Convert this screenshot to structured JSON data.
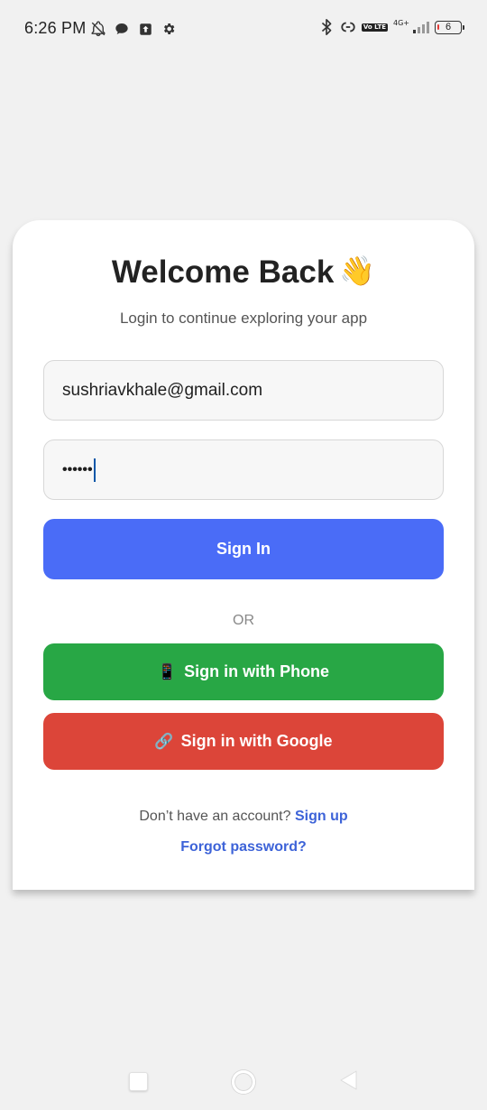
{
  "status_bar": {
    "time": "6:26 PM",
    "network_type": "4G+",
    "volte_label": "Vo LTE",
    "battery_level": "6",
    "icons_left": [
      "bell-off-icon",
      "chat-bubble-icon",
      "upload-icon",
      "gear-icon"
    ],
    "icons_right": [
      "bluetooth-icon",
      "hotspot-link-icon",
      "volte-icon",
      "signal-icon",
      "battery-icon"
    ]
  },
  "login": {
    "title": "Welcome Back",
    "title_emoji": "👋",
    "subtitle": "Login to continue exploring your app",
    "email_value": "sushriavkhale@gmail.com",
    "password_value": "••••••",
    "sign_in_label": "Sign In",
    "or_label": "OR",
    "phone_icon": "📱",
    "phone_label": "Sign in with Phone",
    "google_icon": "🔗",
    "google_label": "Sign in with Google",
    "no_account_text": "Don’t have an account?",
    "sign_up_label": "Sign up",
    "forgot_label": "Forgot password?"
  },
  "colors": {
    "background": "#f1f1f1",
    "card": "#ffffff",
    "sign_in_button": "#4a6cf7",
    "phone_button": "#28a745",
    "google_button": "#dc4539",
    "link": "#3d63d8"
  },
  "nav_bar": {
    "icons": [
      "recents-icon",
      "home-icon",
      "back-icon"
    ]
  }
}
